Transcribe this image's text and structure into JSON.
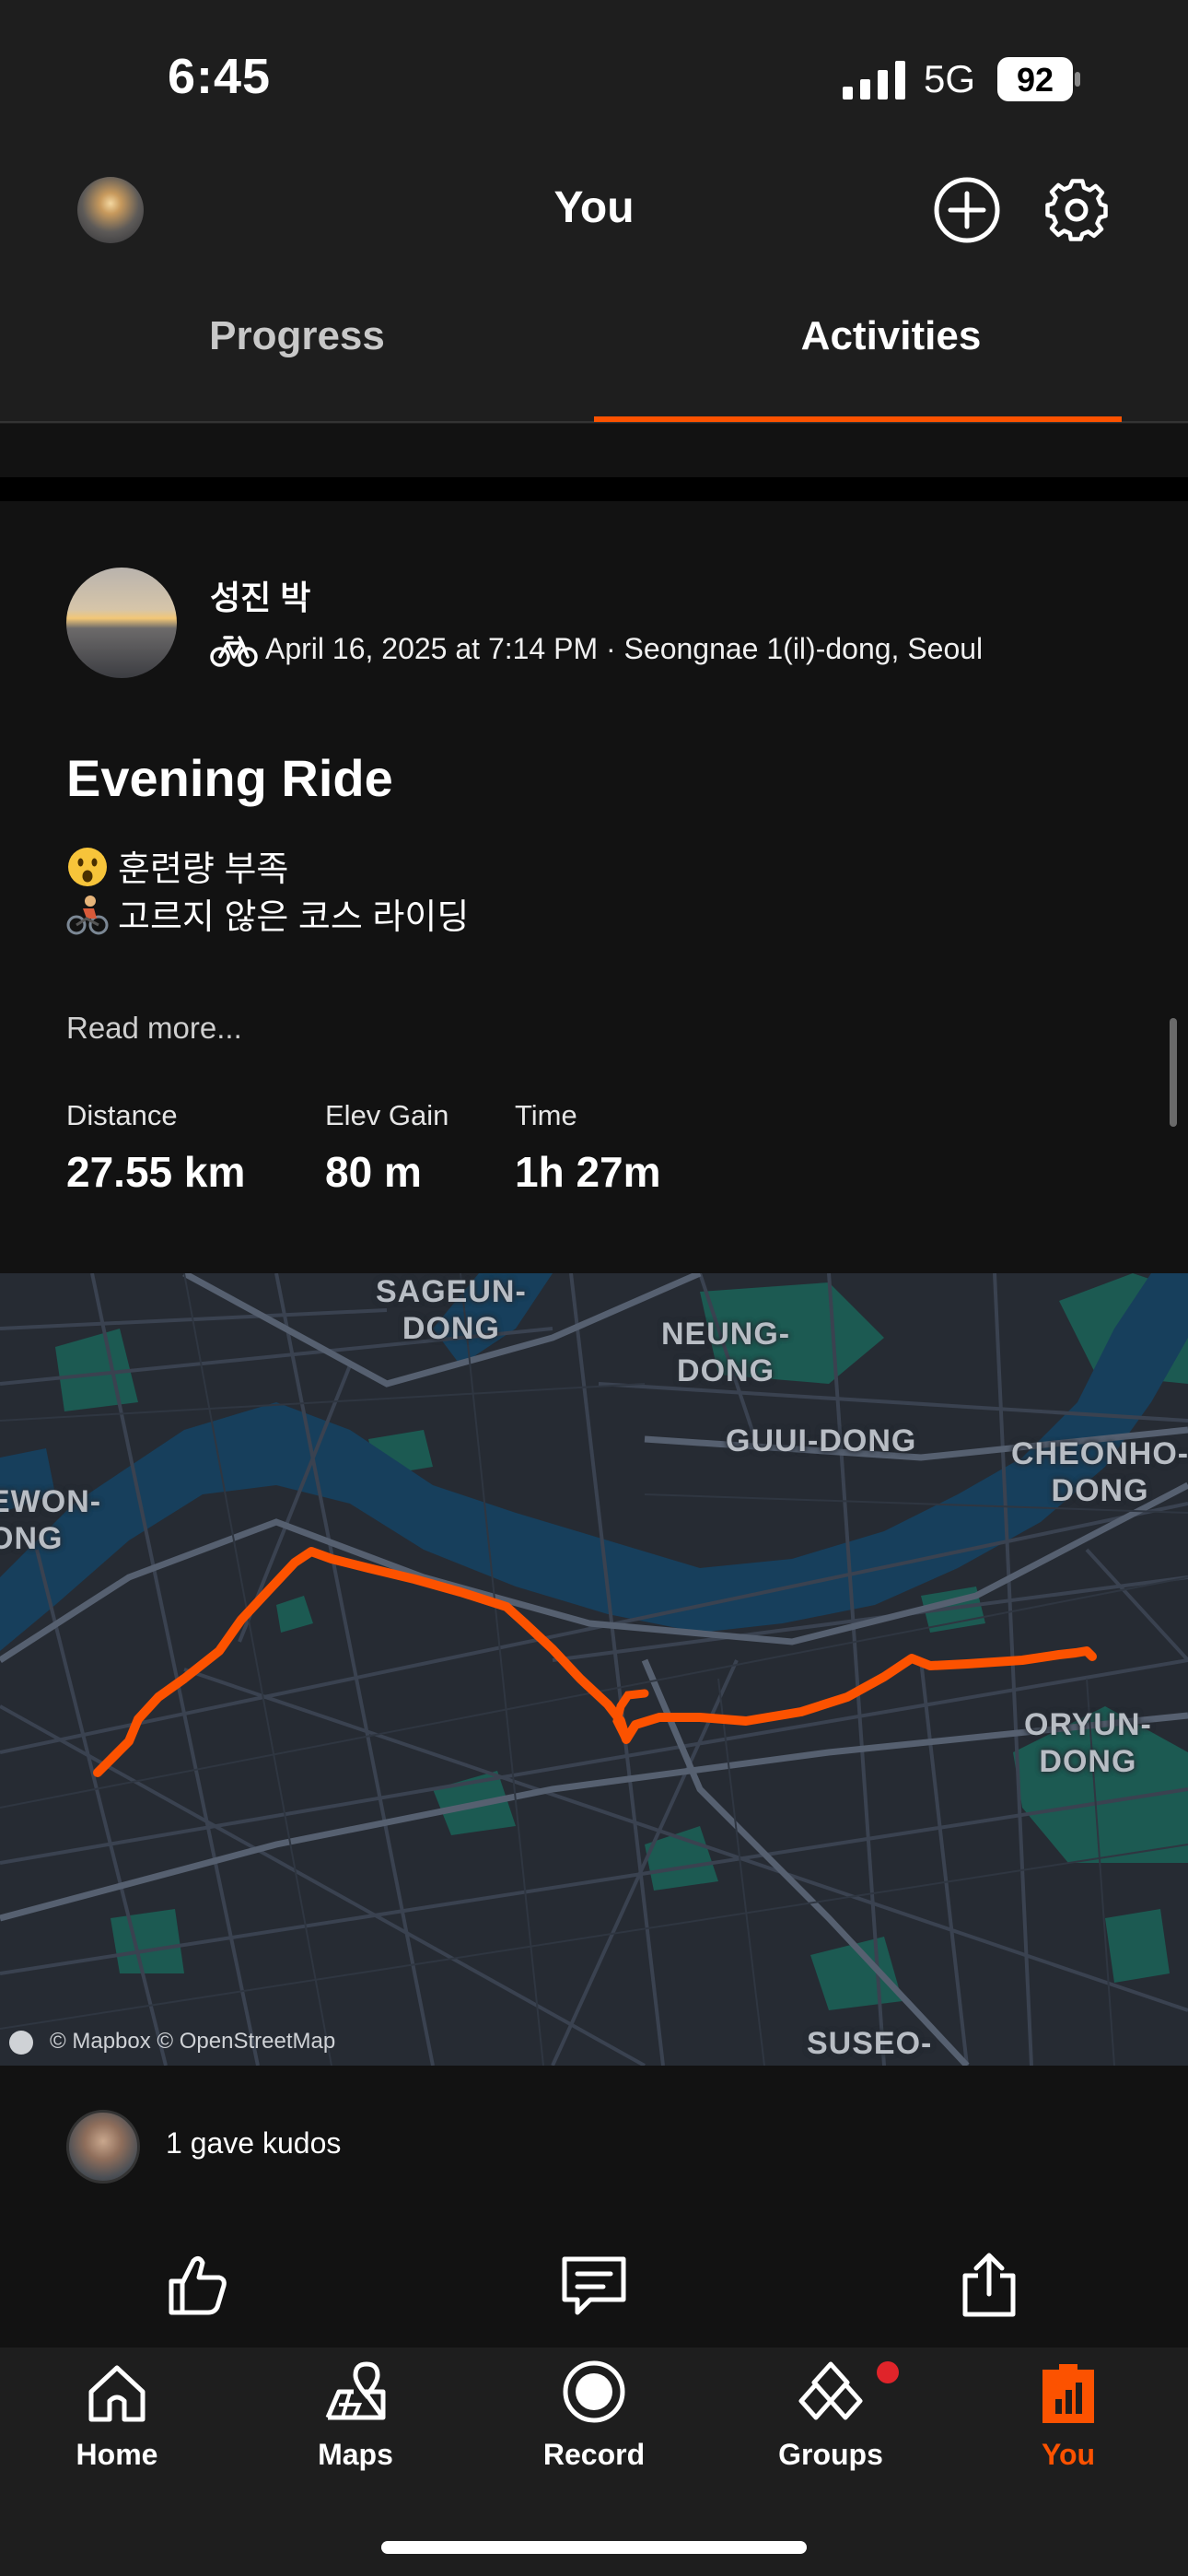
{
  "status_bar": {
    "time": "6:45",
    "network": "5G",
    "battery": "92"
  },
  "header": {
    "title": "You",
    "tabs": [
      {
        "label": "Progress",
        "active": false
      },
      {
        "label": "Activities",
        "active": true
      }
    ],
    "accent_color": "#fc5200"
  },
  "activity": {
    "athlete_name": "성진 박",
    "meta": "April 16, 2025 at 7:14 PM · Seongnae 1(il)-dong, Seoul",
    "title": "Evening Ride",
    "description_lines": [
      {
        "emoji": "astonished-face",
        "text": "훈련량 부족"
      },
      {
        "emoji": "person-biking",
        "text": "고르지 않은 코스 라이딩"
      }
    ],
    "read_more": "Read more...",
    "stats": [
      {
        "label": "Distance",
        "value": "27.55 km"
      },
      {
        "label": "Elev Gain",
        "value": "80 m"
      },
      {
        "label": "Time",
        "value": "1h 27m"
      }
    ],
    "map": {
      "labels": [
        "SAGEUN-\nDONG",
        "NEUNG-\nDONG",
        "GUUI-DONG",
        "CHEONHO-\nDONG",
        "EWON-\nONG",
        "ORYUN-\nDONG",
        "SUSEO-"
      ],
      "attribution": "© Mapbox © OpenStreetMap",
      "route_color": "#fc5200"
    },
    "kudos_text": "1 gave kudos",
    "actions": [
      "kudos-icon",
      "comment-icon",
      "share-icon"
    ]
  },
  "bottom_nav": [
    {
      "label": "Home",
      "icon": "home-icon",
      "active": false
    },
    {
      "label": "Maps",
      "icon": "map-icon",
      "active": false
    },
    {
      "label": "Record",
      "icon": "record-icon",
      "active": false
    },
    {
      "label": "Groups",
      "icon": "groups-icon",
      "active": false,
      "badge": true
    },
    {
      "label": "You",
      "icon": "you-icon",
      "active": true
    }
  ]
}
